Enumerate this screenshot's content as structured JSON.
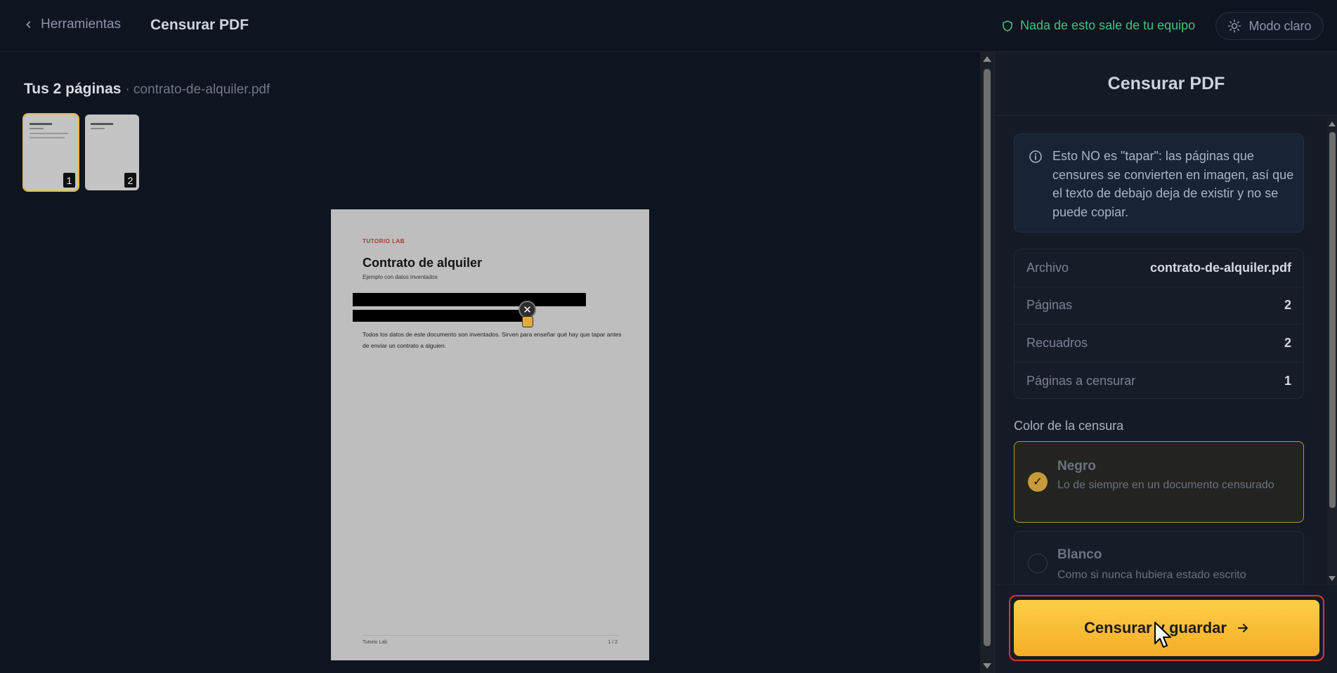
{
  "header": {
    "back_label": "Herramientas",
    "title": "Censurar PDF",
    "privacy_note": "Nada de esto sale de tu equipo",
    "theme_button": "Modo claro"
  },
  "pages": {
    "heading": "Tus 2 páginas",
    "filename": "· contrato-de-alquiler.pdf",
    "thumbnails": [
      {
        "number": "1",
        "active": true
      },
      {
        "number": "2",
        "active": false
      }
    ]
  },
  "document": {
    "brand": "TUTORIO LAB",
    "title": "Contrato de alquiler",
    "subtitle": "Ejemplo con datos inventados",
    "body": "Todos los datos de este documento son inventados. Sirven para enseñar qué hay que tapar antes de enviar un contrato a alguien.",
    "footer_left": "Tutorio Lab",
    "footer_right": "1 / 2",
    "redaction_close": "✕"
  },
  "panel": {
    "title": "Censurar PDF",
    "info_text": "Esto NO es \"tapar\": las páginas que censures se convierten en imagen, así que el texto de debajo deja de existir y no se puede copiar.",
    "meta": [
      {
        "key": "Archivo",
        "value": "contrato-de-alquiler.pdf"
      },
      {
        "key": "Páginas",
        "value": "2"
      },
      {
        "key": "Recuadros",
        "value": "2"
      },
      {
        "key": "Páginas a censurar",
        "value": "1"
      }
    ],
    "color_label": "Color de la censura",
    "options": [
      {
        "name": "Negro",
        "desc": "Lo de siempre en un documento censurado",
        "selected": true,
        "check": "✓"
      },
      {
        "name": "Blanco",
        "desc": "Como si nunca hubiera estado escrito",
        "selected": false
      }
    ],
    "cta_label": "Censurar y guardar"
  },
  "colors": {
    "accent": "#f4ad28",
    "privacy_green": "#43c07a",
    "cta_outline": "#e0332f",
    "background": "#0e1420"
  }
}
